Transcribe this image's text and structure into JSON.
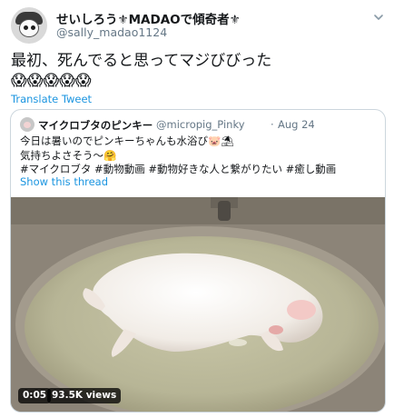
{
  "author": {
    "display_name": "せいしろう⚜MADAOで傾奇者⚜",
    "handle": "@sally_madao1124"
  },
  "tweet": {
    "text": "最初、死んでると思ってマジびびった",
    "emojis": "😱😱😱😱😱",
    "translate_label": "Translate Tweet"
  },
  "quoted": {
    "display_name": "マイクロブタのピンキー",
    "handle": "@micropig_Pinky",
    "separator": "·",
    "date": "Aug 24",
    "lines": [
      "今日は暑いのでピンキーちゃんも水浴び🐷⛱",
      "気持ちよさそう〜🤗",
      "#マイクロブタ #動物動画 #動物好きな人と繋がりたい #癒し動画"
    ],
    "show_thread_label": "Show this thread"
  },
  "video": {
    "timecode": "0:05",
    "views": "93.5K views"
  },
  "icons": {
    "more": "chevron-down-icon"
  },
  "colors": {
    "link": "#1b95e0",
    "secondary_text": "#657786",
    "border": "#ccd6dd"
  }
}
